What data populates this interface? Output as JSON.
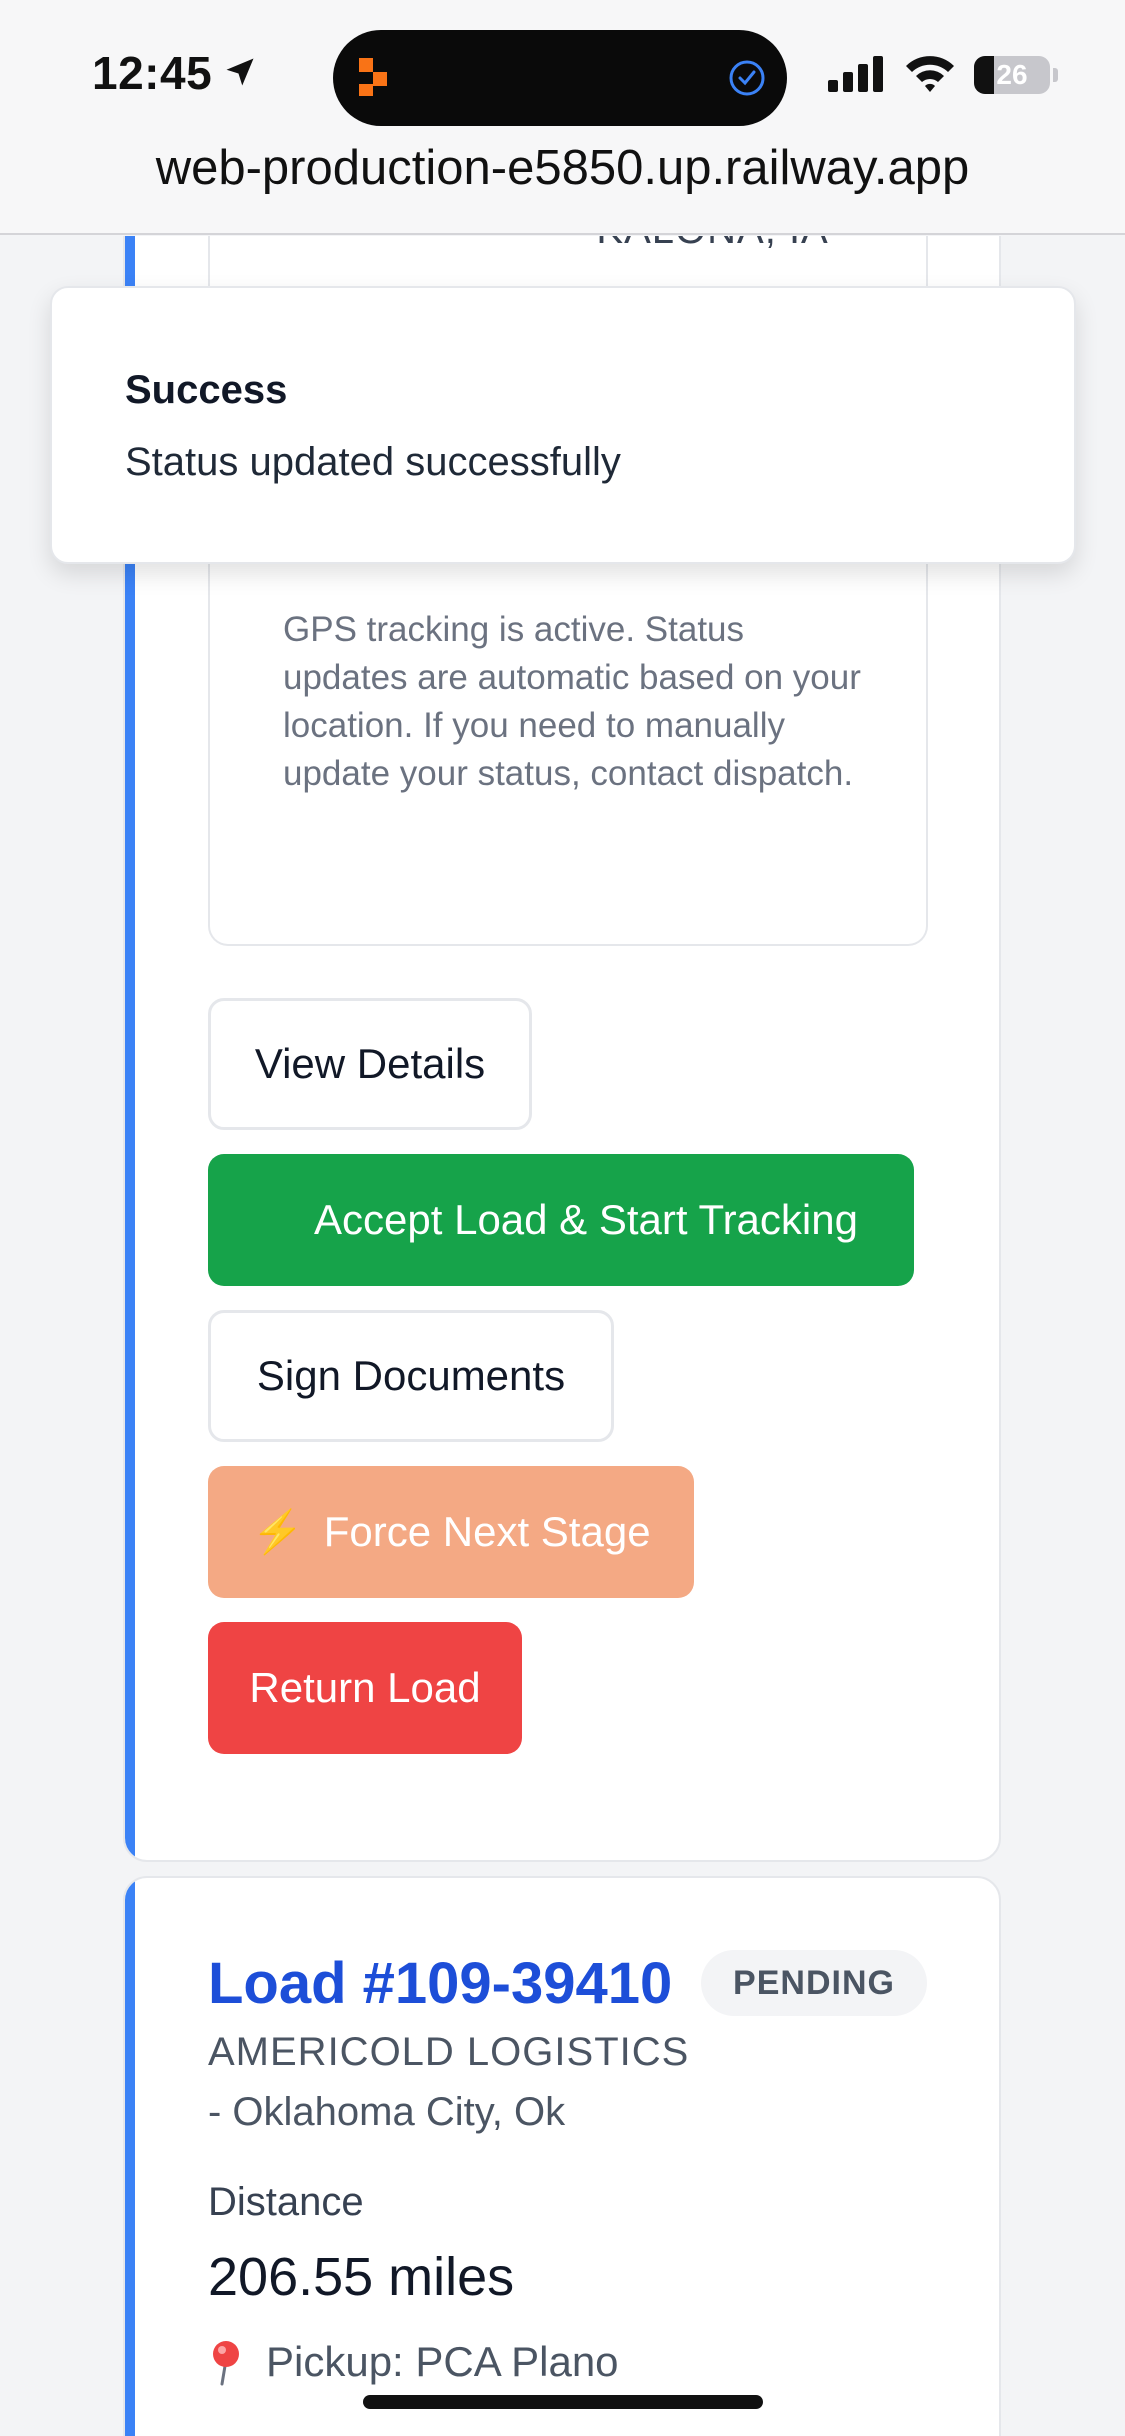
{
  "status_bar": {
    "time": "12:45",
    "battery_level": "26",
    "battery_fraction": 0.26
  },
  "browser": {
    "url": "web-production-e5850.up.railway.app"
  },
  "current_load": {
    "location_partial": "- KALONA, IA",
    "gps_note": "GPS tracking is active. Status updates are automatic based on your location. If you need to manually update your status, contact dispatch.",
    "buttons": {
      "view_details": "View Details",
      "accept_load": "Accept Load & Start Tracking",
      "sign_documents": "Sign Documents",
      "force_next_stage_icon": "⚡",
      "force_next_stage": "Force Next Stage",
      "return_load": "Return Load"
    }
  },
  "next_load": {
    "title": "Load #109-39410",
    "status": "PENDING",
    "shipper": "AMERICOLD LOGISTICS",
    "shipper_city": "- Oklahoma City, Ok",
    "distance_label": "Distance",
    "distance_value": "206.55 miles",
    "pickup": "Pickup: PCA Plano"
  },
  "toast": {
    "title": "Success",
    "message": "Status updated successfully"
  },
  "colors": {
    "accent_blue": "#3b82f6",
    "title_blue": "#1d4ed8",
    "accept_green": "#16a34a",
    "force_orange": "#f4a984",
    "return_red": "#ef4444"
  }
}
